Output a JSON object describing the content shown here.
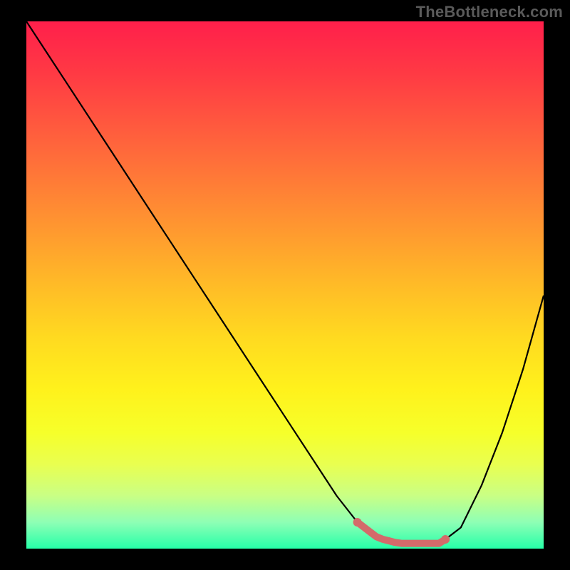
{
  "watermark": "TheBottleneck.com",
  "chart_data": {
    "type": "line",
    "title": "",
    "xlabel": "",
    "ylabel": "",
    "xlim": [
      0,
      100
    ],
    "ylim": [
      0,
      100
    ],
    "grid": false,
    "legend": false,
    "series": [
      {
        "name": "bottleneck-curve",
        "x": [
          0,
          4,
          8,
          12,
          16,
          20,
          24,
          28,
          32,
          36,
          40,
          44,
          48,
          52,
          56,
          60,
          64,
          68,
          72,
          76,
          80,
          84,
          88,
          92,
          96,
          100
        ],
        "y": [
          100,
          94,
          88,
          82,
          76,
          70,
          64,
          58,
          52,
          46,
          40,
          34,
          28,
          22,
          16,
          10,
          5,
          2,
          1,
          1,
          1,
          4,
          12,
          22,
          34,
          48
        ]
      }
    ],
    "annotations": [
      {
        "name": "optimal-range",
        "x_start": 64,
        "x_end": 81,
        "y_level": 1.5
      }
    ],
    "background_gradient_meaning": "top=worst (red) → bottom=best (green)"
  }
}
